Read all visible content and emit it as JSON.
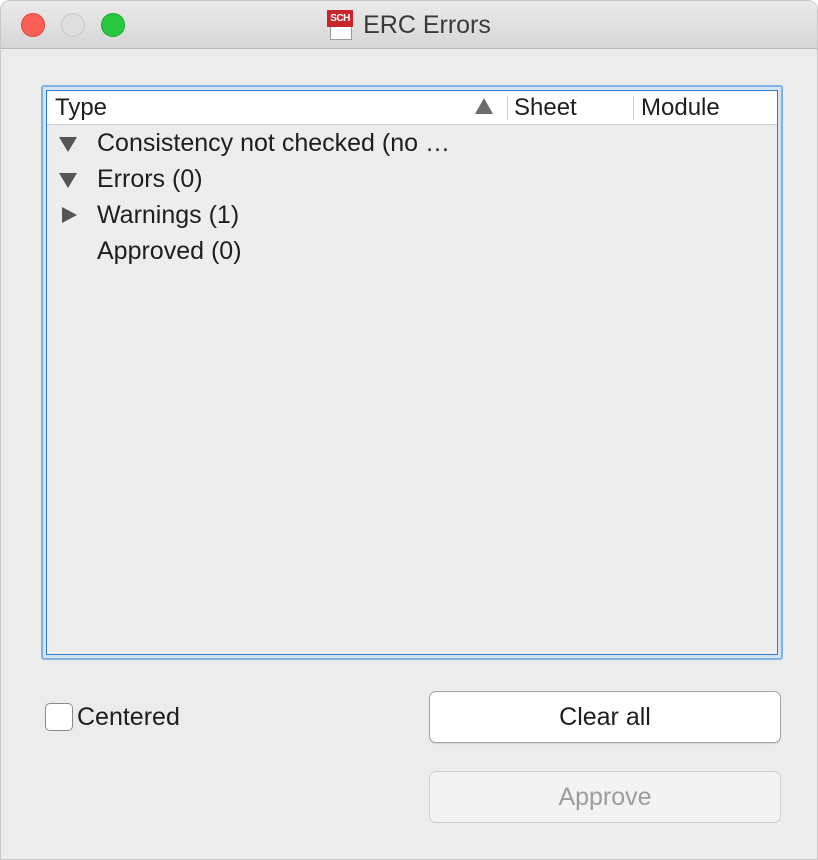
{
  "window": {
    "title": "ERC Errors",
    "app_icon_text": "SCH"
  },
  "table": {
    "columns": {
      "type": "Type",
      "sheet": "Sheet",
      "module": "Module"
    },
    "sort_column": "Type",
    "sort_direction": "ascending",
    "rows": [
      {
        "label": "Consistency not checked (no …",
        "expander": "expanded"
      },
      {
        "label": "Errors (0)",
        "expander": "expanded"
      },
      {
        "label": "Warnings (1)",
        "expander": "collapsed"
      },
      {
        "label": "Approved (0)",
        "expander": "none"
      }
    ]
  },
  "options": {
    "centered_label": "Centered",
    "centered_checked": false
  },
  "buttons": {
    "clear_all": "Clear all",
    "approve": "Approve"
  },
  "colors": {
    "close": "#fe5f57",
    "maximize": "#28c840",
    "focus_ring": "#2f7fd0",
    "app_icon": "#c8252c"
  }
}
